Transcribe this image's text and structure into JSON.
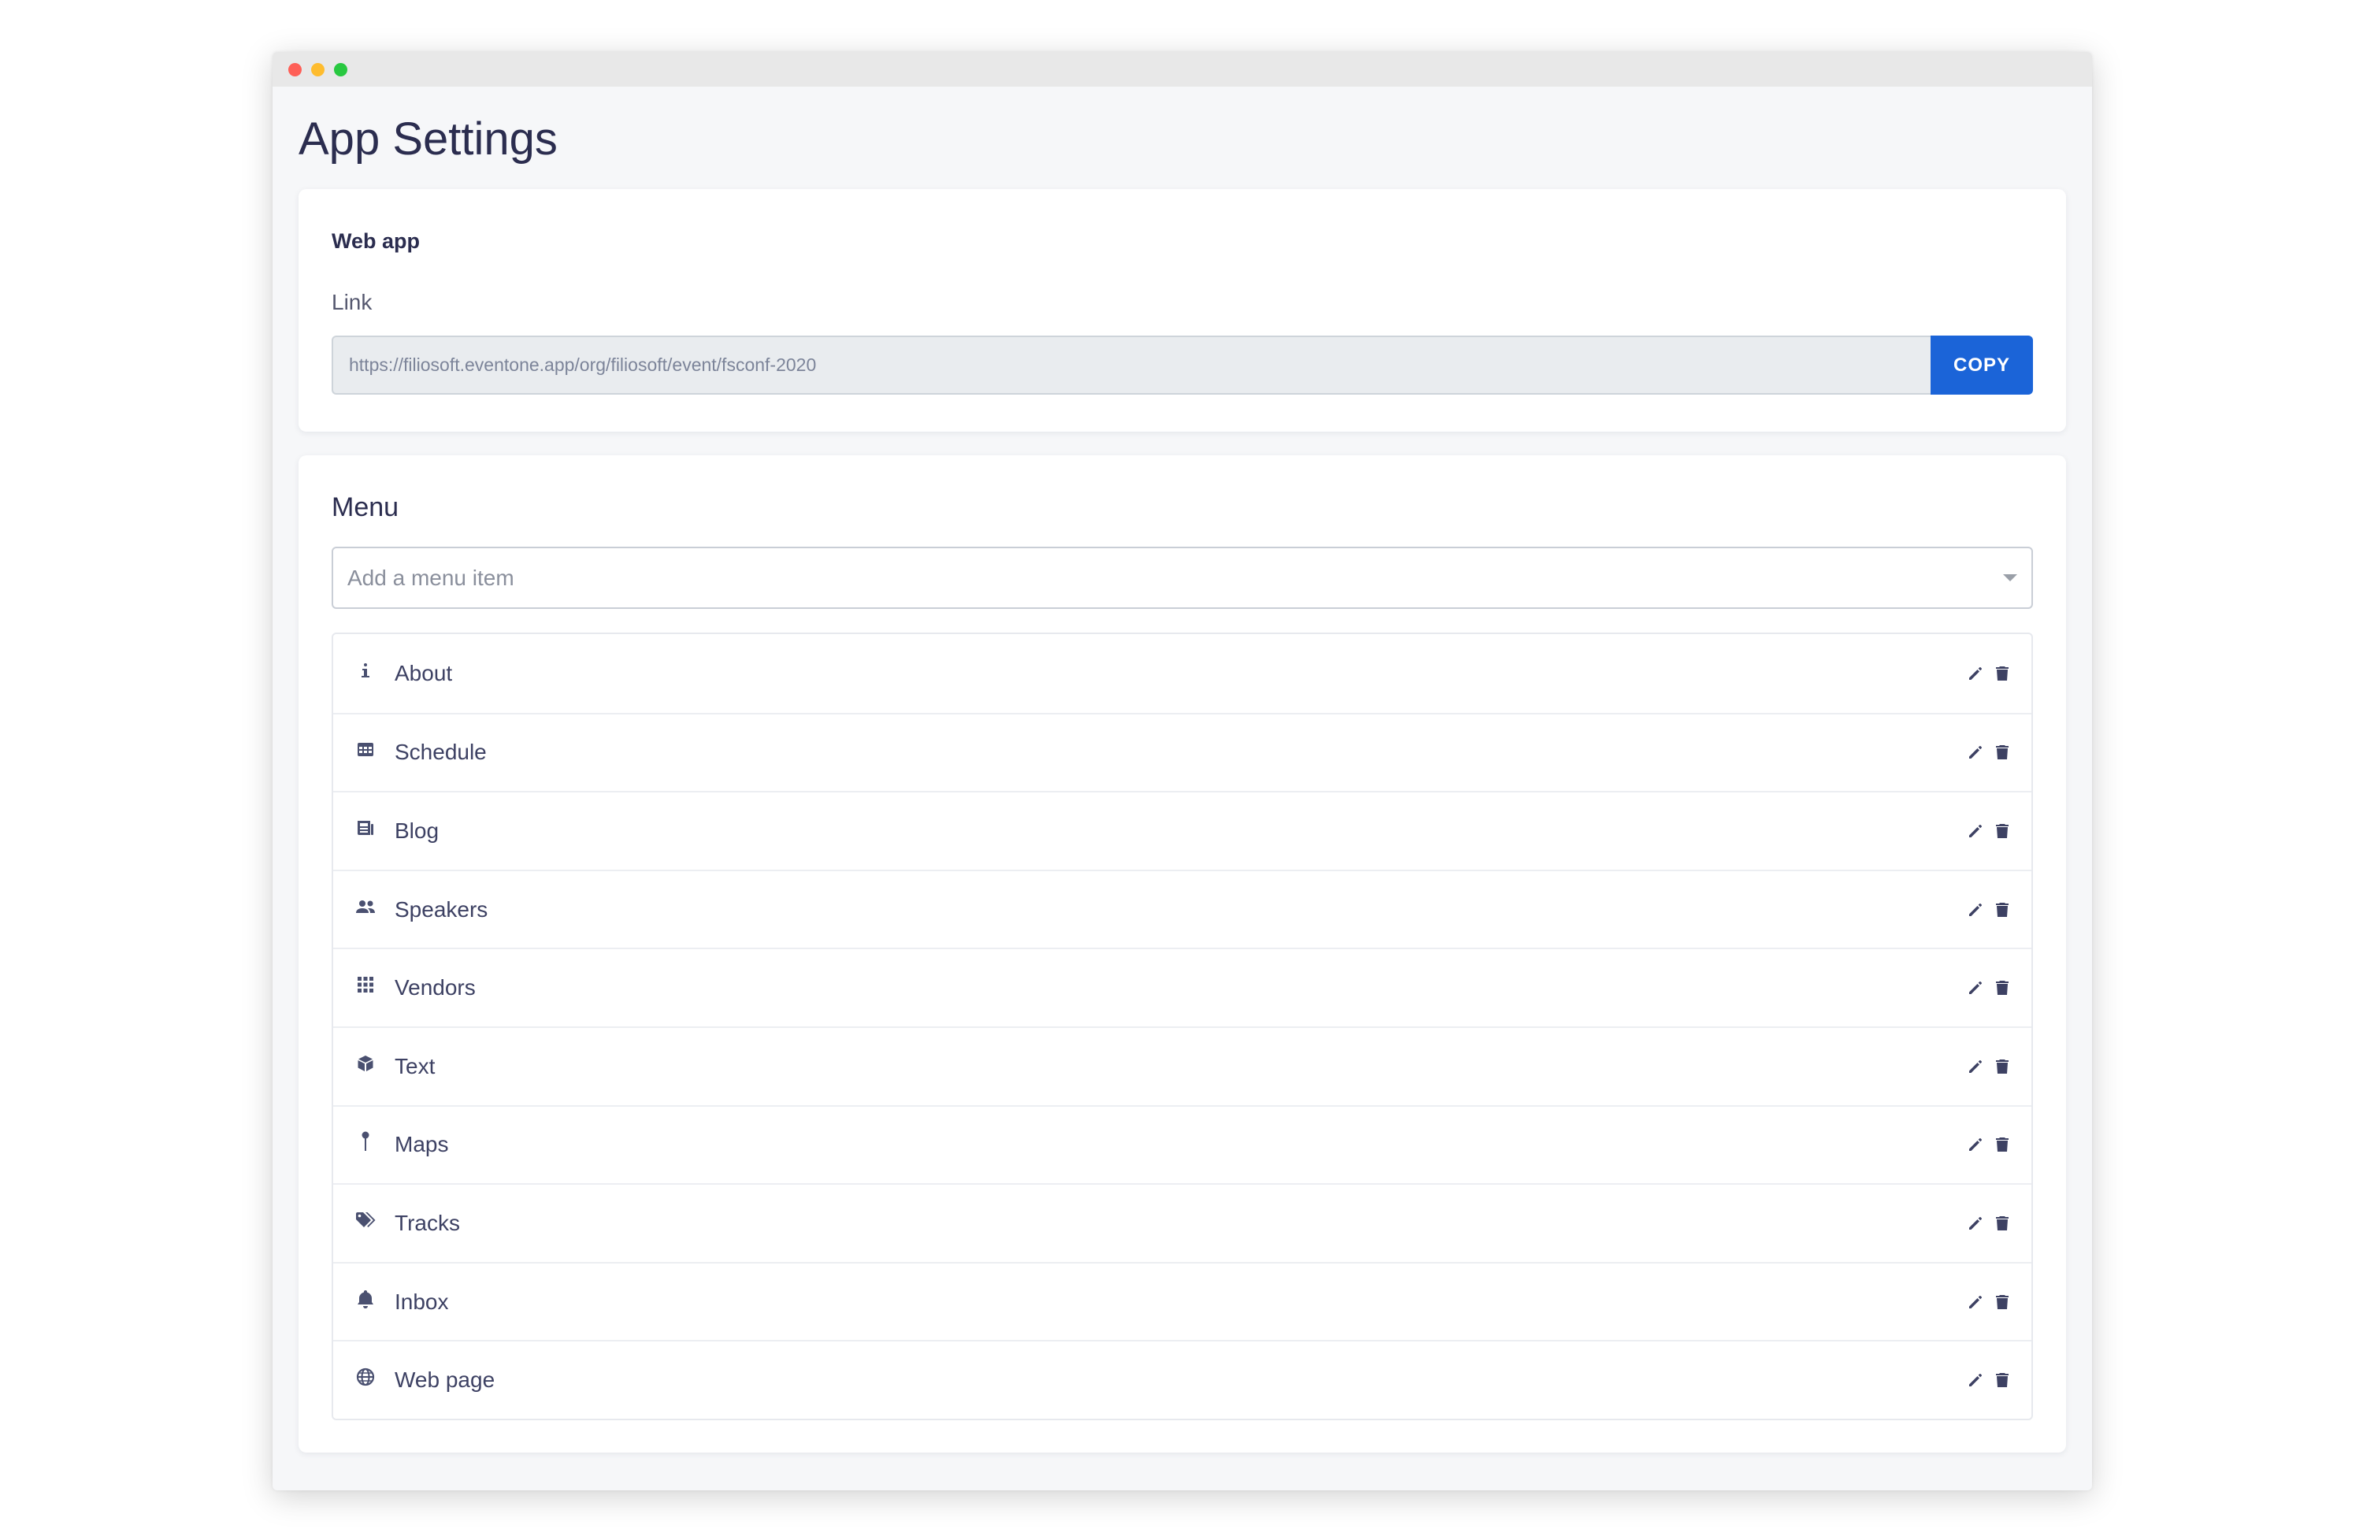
{
  "page": {
    "title": "App Settings"
  },
  "web_app": {
    "heading": "Web app",
    "link_label": "Link",
    "link_value": "https://filiosoft.eventone.app/org/filiosoft/event/fsconf-2020",
    "copy_label": "COPY"
  },
  "menu": {
    "heading": "Menu",
    "select_placeholder": "Add a menu item",
    "items": [
      {
        "label": "About",
        "icon": "info-icon"
      },
      {
        "label": "Schedule",
        "icon": "calendar-icon"
      },
      {
        "label": "Blog",
        "icon": "newspaper-icon"
      },
      {
        "label": "Speakers",
        "icon": "users-icon"
      },
      {
        "label": "Vendors",
        "icon": "grid-icon"
      },
      {
        "label": "Text",
        "icon": "cube-icon"
      },
      {
        "label": "Maps",
        "icon": "map-pin-icon"
      },
      {
        "label": "Tracks",
        "icon": "tags-icon"
      },
      {
        "label": "Inbox",
        "icon": "bell-icon"
      },
      {
        "label": "Web page",
        "icon": "globe-icon"
      }
    ]
  },
  "colors": {
    "accent": "#1b64d8",
    "text": "#2b2d4f",
    "icon": "#4a5070",
    "window_bg": "#f6f7f9",
    "traffic_red": "#fe5f57",
    "traffic_yellow": "#febc2e",
    "traffic_green": "#28c840"
  }
}
